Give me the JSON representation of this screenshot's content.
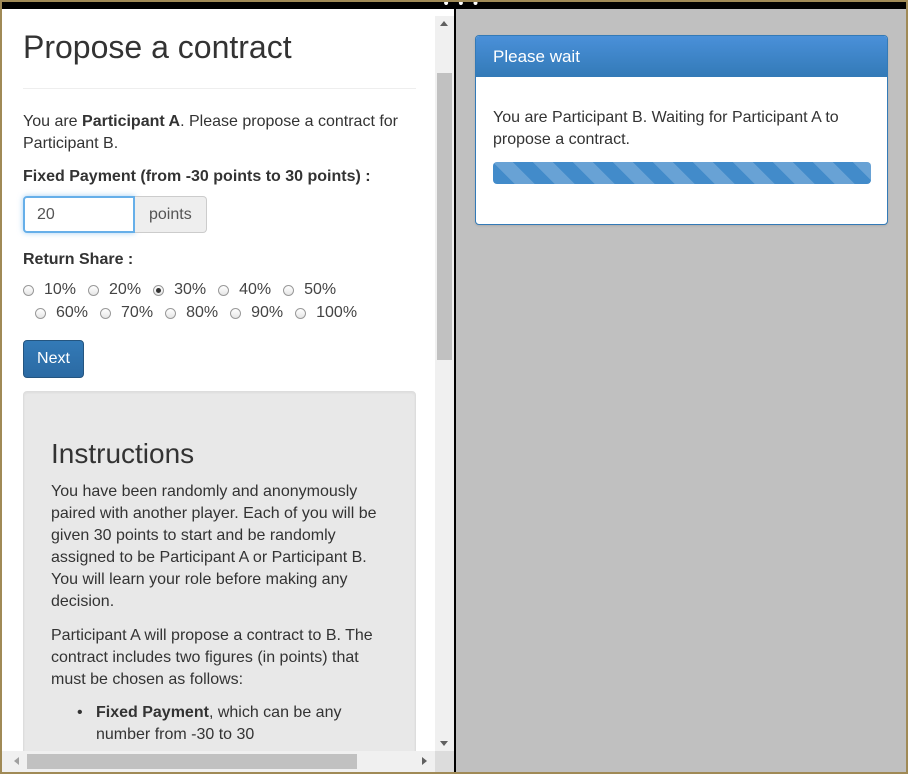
{
  "left": {
    "title": "Propose a contract",
    "intro_pre": "You are ",
    "intro_role": "Participant A",
    "intro_post": ". Please propose a contract for Participant B.",
    "fixed_label": "Fixed Payment (from -30 points to 30 points) :",
    "fixed_value": "20",
    "fixed_addon": "points",
    "share_label": "Return Share :",
    "share_options_row1": [
      "10%",
      "20%",
      "30%",
      "40%",
      "50%"
    ],
    "share_options_row2": [
      "60%",
      "70%",
      "80%",
      "90%",
      "100%"
    ],
    "share_selected": "30%",
    "next_label": "Next",
    "instructions": {
      "title": "Instructions",
      "p1": "You have been randomly and anonymously paired with another player. Each of you will be given 30 points to start and be randomly assigned to be Participant A or Participant B. You will learn your role before making any decision.",
      "p2": "Participant A will propose a contract to B. The contract includes two figures (in points) that must be chosen as follows:",
      "bullet1_bold": "Fixed Payment",
      "bullet1_rest": ", which can be any number from -30 to 30"
    }
  },
  "right": {
    "panel_title": "Please wait",
    "panel_text": "You are Participant B. Waiting for Participant A to propose a contract.",
    "progress_percent": 100
  },
  "colors": {
    "primary": "#337ab7",
    "frame": "#a08a56",
    "pane_bg": "#c0c0c0"
  }
}
